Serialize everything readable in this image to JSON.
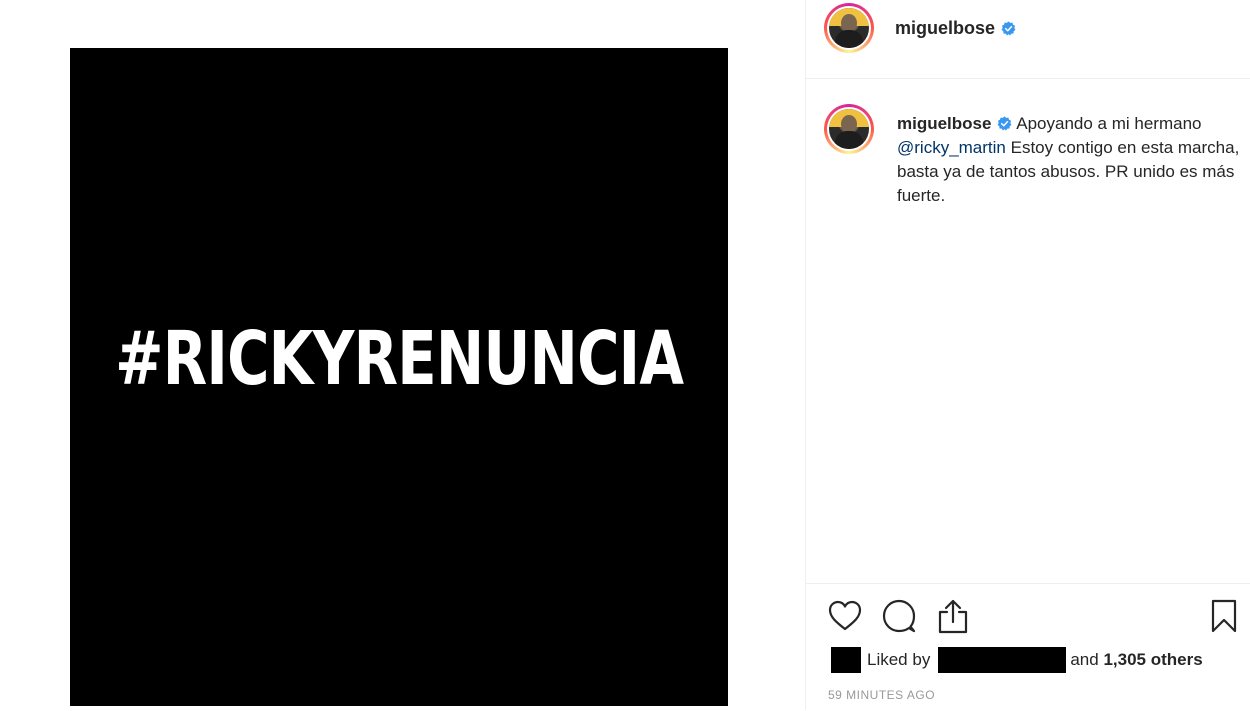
{
  "post": {
    "image_text": "#RICKYRENUNCIA"
  },
  "header": {
    "username": "miguelbose"
  },
  "caption": {
    "username": "miguelbose",
    "text_before": " Apoyando a mi hermano ",
    "mention": "@ricky_martin",
    "text_after": " Estoy contigo en esta marcha, basta ya de tantos abusos. PR unido es más fuerte."
  },
  "actions": {
    "like_icon": "heart-icon",
    "comment_icon": "comment-icon",
    "share_icon": "share-icon",
    "save_icon": "bookmark-icon"
  },
  "likes": {
    "liked_by": "Liked by",
    "and_word": "and",
    "others": "1,305 others"
  },
  "timestamp": "59 MINUTES AGO",
  "colors": {
    "verified": "#3897f0",
    "mention": "#003569",
    "timestamp": "#999999"
  }
}
